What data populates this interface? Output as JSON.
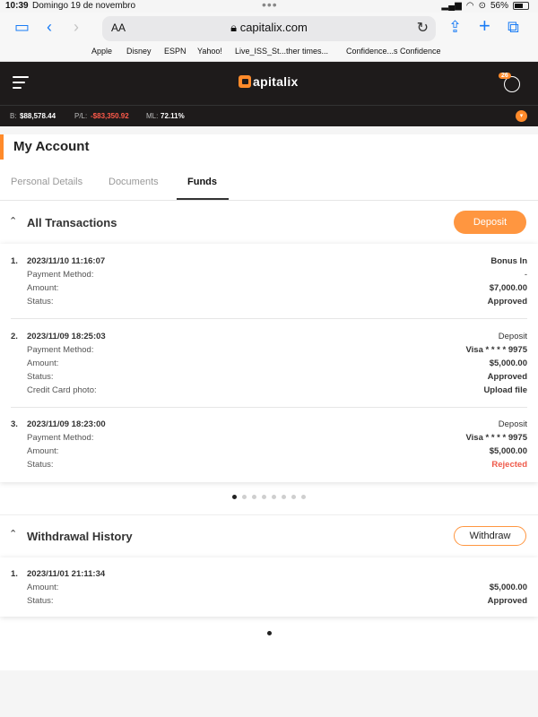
{
  "status_bar": {
    "time": "10:39",
    "date": "Domingo 19 de novembro",
    "dots": "•••",
    "battery": "56%"
  },
  "browser": {
    "aa": "AA",
    "url": "capitalix.com",
    "bookmarks": [
      "Apple",
      "Disney",
      "ESPN",
      "Yahoo!",
      "Live_ISS_St...ther times...",
      "Confidence...s Confidence"
    ]
  },
  "app": {
    "brand": "Capitalix",
    "notification_count": "26",
    "accent_color": "#ff8a2a"
  },
  "balances": {
    "balance_label": "B:",
    "balance_value": "$88,578.44",
    "pl_label": "P/L:",
    "pl_value": "-$83,350.92",
    "ml_label": "ML:",
    "ml_value": "72.11%"
  },
  "account": {
    "title": "My Account",
    "tabs": [
      "Personal Details",
      "Documents",
      "Funds"
    ],
    "active_tab": "Funds"
  },
  "transactions": {
    "title": "All Transactions",
    "deposit_label": "Deposit",
    "items": [
      {
        "num": "1.",
        "datetime": "2023/11/10 11:16:07",
        "type": "Bonus In",
        "payment_label": "Payment Method:",
        "payment_value": "-",
        "amount_label": "Amount:",
        "amount": "$7,000.00",
        "status_label": "Status:",
        "status": "Approved"
      },
      {
        "num": "2.",
        "datetime": "2023/11/09 18:25:03",
        "type": "Deposit",
        "payment_label": "Payment Method:",
        "payment_value": "Visa  * * * *  9975",
        "amount_label": "Amount:",
        "amount": "$5,000.00",
        "status_label": "Status:",
        "status": "Approved",
        "photo_label": "Credit Card photo:",
        "photo_value": "Upload file"
      },
      {
        "num": "3.",
        "datetime": "2023/11/09 18:23:00",
        "type": "Deposit",
        "payment_label": "Payment Method:",
        "payment_value": "Visa  * * * *  9975",
        "amount_label": "Amount:",
        "amount": "$5,000.00",
        "status_label": "Status:",
        "status": "Rejected"
      }
    ],
    "pager_total": 8,
    "pager_active": 1
  },
  "withdrawals": {
    "title": "Withdrawal History",
    "withdraw_label": "Withdraw",
    "items": [
      {
        "num": "1.",
        "datetime": "2023/11/01 21:11:34",
        "amount_label": "Amount:",
        "amount": "$5,000.00",
        "status_label": "Status:",
        "status": "Approved"
      }
    ],
    "pager_total": 1,
    "pager_active": 1
  }
}
